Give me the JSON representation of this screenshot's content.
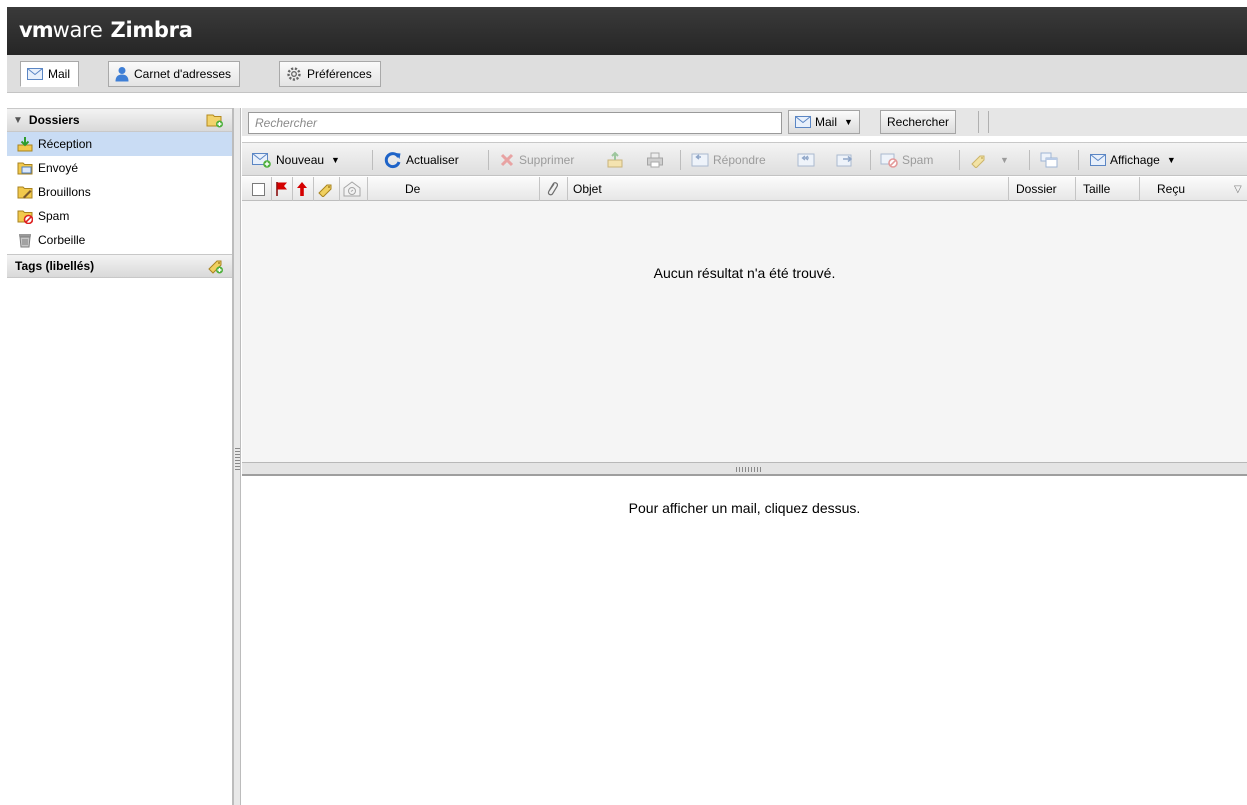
{
  "brand": {
    "vm": "vm",
    "ware": "ware",
    "product": "Zimbra"
  },
  "app_tabs": [
    {
      "label": "Mail",
      "icon": "mail-icon",
      "active": true
    },
    {
      "label": "Carnet d'adresses",
      "icon": "contacts-icon",
      "active": false
    },
    {
      "label": "Préférences",
      "icon": "gear-icon",
      "active": false
    }
  ],
  "sidebar": {
    "folders_header": "Dossiers",
    "folders": [
      {
        "label": "Réception",
        "icon": "inbox-icon",
        "selected": true
      },
      {
        "label": "Envoyé",
        "icon": "sent-icon",
        "selected": false
      },
      {
        "label": "Brouillons",
        "icon": "drafts-icon",
        "selected": false
      },
      {
        "label": "Spam",
        "icon": "spam-folder-icon",
        "selected": false
      },
      {
        "label": "Corbeille",
        "icon": "trash-icon",
        "selected": false
      }
    ],
    "tags_header": "Tags (libellés)"
  },
  "search": {
    "placeholder": "Rechercher",
    "value": "",
    "type_label": "Mail",
    "button_label": "Rechercher"
  },
  "toolbar": {
    "new_label": "Nouveau",
    "refresh_label": "Actualiser",
    "delete_label": "Supprimer",
    "reply_label": "Répondre",
    "spam_label": "Spam",
    "view_label": "Affichage"
  },
  "columns": {
    "from": "De",
    "subject": "Objet",
    "folder": "Dossier",
    "size": "Taille",
    "received": "Reçu"
  },
  "list": {
    "empty_message": "Aucun résultat n'a été trouvé."
  },
  "reading_pane": {
    "empty_message": "Pour afficher un mail, cliquez dessus."
  },
  "colors": {
    "topbar": "#2e2e2e",
    "selection": "#c9dcf4",
    "flag_red": "#d40000",
    "folder_yellow": "#f2c94c"
  }
}
